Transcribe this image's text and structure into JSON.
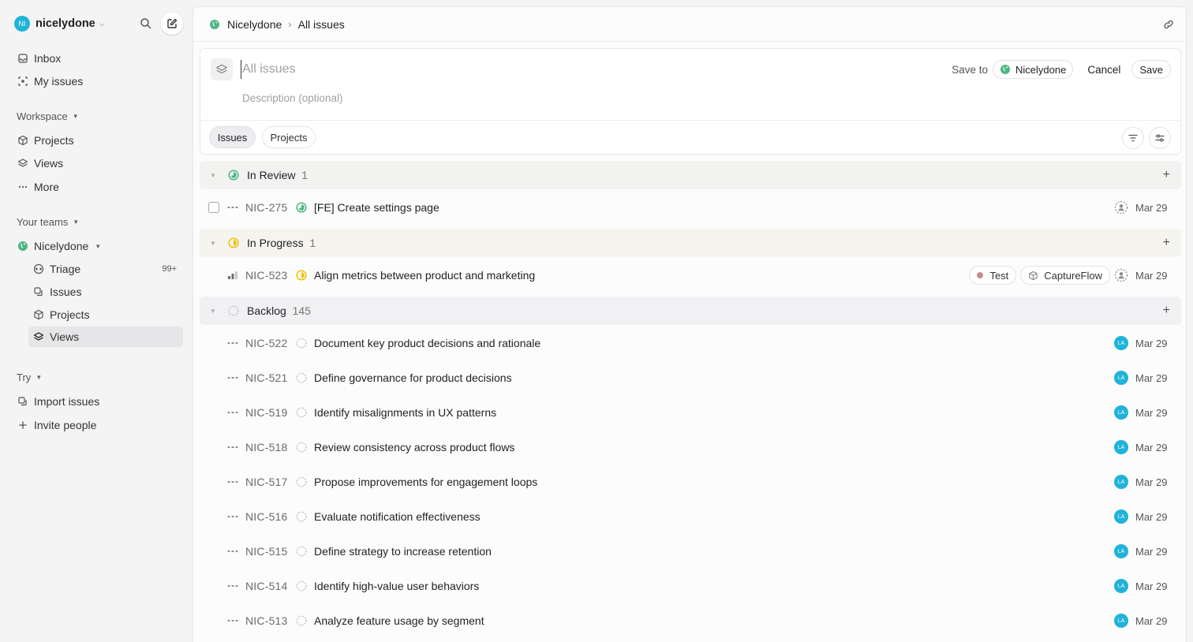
{
  "workspace": {
    "initials": "NI",
    "name": "nicelydone",
    "avatar_color": "#1fb3d9"
  },
  "sidebar": {
    "top_items": [
      {
        "label": "Inbox",
        "icon": "inbox-icon"
      },
      {
        "label": "My issues",
        "icon": "target-icon"
      }
    ],
    "workspace_heading": "Workspace",
    "workspace_items": [
      {
        "label": "Projects",
        "icon": "cube-icon"
      },
      {
        "label": "Views",
        "icon": "layers-icon"
      },
      {
        "label": "More",
        "icon": "more-icon"
      }
    ],
    "teams_heading": "Your teams",
    "team_name": "Nicelydone",
    "team_items": [
      {
        "label": "Triage",
        "icon": "triage-icon",
        "count": "99+"
      },
      {
        "label": "Issues",
        "icon": "issues-icon"
      },
      {
        "label": "Projects",
        "icon": "cube-icon"
      },
      {
        "label": "Views",
        "icon": "layers-icon",
        "active": true
      }
    ],
    "try_heading": "Try",
    "try_items": [
      {
        "label": "Import issues",
        "icon": "import-icon"
      },
      {
        "label": "Invite people",
        "icon": "plus-icon"
      }
    ]
  },
  "breadcrumb": {
    "team": "Nicelydone",
    "page": "All issues"
  },
  "view_form": {
    "title_placeholder": "All issues",
    "description_placeholder": "Description (optional)",
    "save_to_label": "Save to",
    "save_to_team": "Nicelydone",
    "cancel_label": "Cancel",
    "save_label": "Save",
    "tabs": [
      "Issues",
      "Projects"
    ],
    "active_tab": "Issues"
  },
  "colors": {
    "in_review": "#4cb782",
    "in_progress": "#f2be00",
    "backlog": "#bcbcc0",
    "tag_test": "#c98a8a"
  },
  "groups": [
    {
      "name": "In Review",
      "count": "1",
      "status": "in-review",
      "issues": [
        {
          "id": "NIC-275",
          "title": "[FE] Create settings page",
          "priority": "none",
          "checkbox": true,
          "assignee": "unassigned",
          "date": "Mar 29",
          "tags": []
        }
      ]
    },
    {
      "name": "In Progress",
      "count": "1",
      "status": "in-progress",
      "issues": [
        {
          "id": "NIC-523",
          "title": "Align metrics between product and marketing",
          "priority": "high",
          "checkbox": false,
          "assignee": "unassigned",
          "date": "Mar 29",
          "tags": [
            {
              "label": "Test",
              "kind": "label"
            },
            {
              "label": "CaptureFlow",
              "kind": "project"
            }
          ]
        }
      ]
    },
    {
      "name": "Backlog",
      "count": "145",
      "status": "backlog",
      "issues": [
        {
          "id": "NIC-522",
          "title": "Document key product decisions and rationale",
          "priority": "none",
          "assignee": "LA",
          "date": "Mar 29",
          "tags": []
        },
        {
          "id": "NIC-521",
          "title": "Define governance for product decisions",
          "priority": "none",
          "assignee": "LA",
          "date": "Mar 29",
          "tags": []
        },
        {
          "id": "NIC-519",
          "title": "Identify misalignments in UX patterns",
          "priority": "none",
          "assignee": "LA",
          "date": "Mar 29",
          "tags": []
        },
        {
          "id": "NIC-518",
          "title": "Review consistency across product flows",
          "priority": "none",
          "assignee": "LA",
          "date": "Mar 29",
          "tags": []
        },
        {
          "id": "NIC-517",
          "title": "Propose improvements for engagement loops",
          "priority": "none",
          "assignee": "LA",
          "date": "Mar 29",
          "tags": []
        },
        {
          "id": "NIC-516",
          "title": "Evaluate notification effectiveness",
          "priority": "none",
          "assignee": "LA",
          "date": "Mar 29",
          "tags": []
        },
        {
          "id": "NIC-515",
          "title": "Define strategy to increase retention",
          "priority": "none",
          "assignee": "LA",
          "date": "Mar 29",
          "tags": []
        },
        {
          "id": "NIC-514",
          "title": "Identify high-value user behaviors",
          "priority": "none",
          "assignee": "LA",
          "date": "Mar 29",
          "tags": []
        },
        {
          "id": "NIC-513",
          "title": "Analyze feature usage by segment",
          "priority": "none",
          "assignee": "LA",
          "date": "Mar 29",
          "tags": []
        }
      ]
    }
  ]
}
